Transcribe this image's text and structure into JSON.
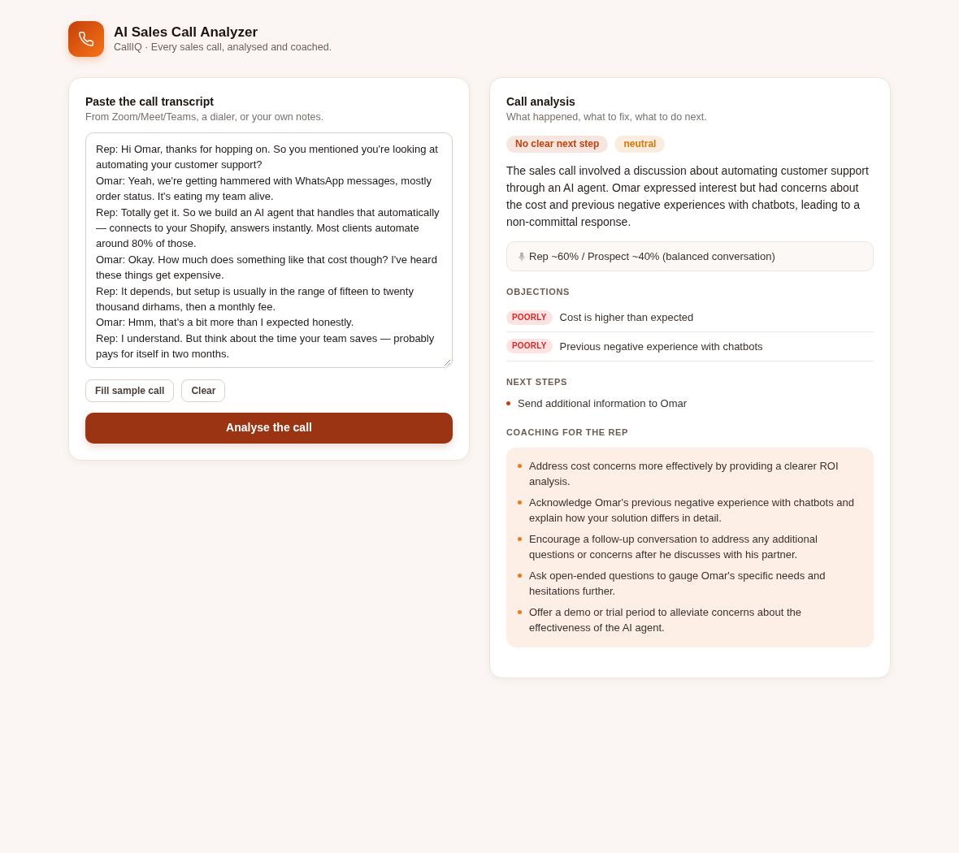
{
  "header": {
    "title": "AI Sales Call Analyzer",
    "subtitle": "CallIQ · Every sales call, analysed and coached."
  },
  "transcript_panel": {
    "title": "Paste the call transcript",
    "subtitle": "From Zoom/Meet/Teams, a dialer, or your own notes.",
    "transcript": [
      "Rep: Hi Omar, thanks for hopping on. So you mentioned you're looking at automating your customer support?",
      "Omar: Yeah, we're getting hammered with WhatsApp messages, mostly order status. It's eating my team alive.",
      "Rep: Totally get it. So we build an AI agent that handles that automatically — connects to your Shopify, answers instantly. Most clients automate around 80% of those.",
      "Omar: Okay. How much does something like that cost though? I've heard these things get expensive.",
      "Rep: It depends, but setup is usually in the range of fifteen to twenty thousand dirhams, then a monthly fee.",
      "Omar: Hmm, that's a bit more than I expected honestly.",
      "Rep: I understand. But think about the time your team saves — probably pays for itself in two months."
    ],
    "buttons": [
      {
        "label": "Fill sample call",
        "kind": "secondary"
      },
      {
        "label": "Clear",
        "kind": "secondary"
      },
      {
        "label": "Analyse the call",
        "kind": "primary"
      }
    ]
  },
  "analysis_panel": {
    "title": "Call analysis",
    "subtitle": "What happened, what to fix, what to do next.",
    "tags": [
      {
        "label": "No clear next step",
        "color": "#c2410c"
      },
      {
        "label": "neutral",
        "color": "#d97706"
      }
    ],
    "summary": "The sales call involved a discussion about automating customer support through an AI agent. Omar expressed interest but had concerns about the cost and previous negative experiences with chatbots, leading to a non-committal response.",
    "talk_ratio": "Rep ~60% / Prospect ~40% (balanced conversation)",
    "objections": {
      "heading": "OBJECTIONS",
      "items": [
        {
          "handling": "POORLY",
          "text": "Cost is higher than expected"
        },
        {
          "handling": "POORLY",
          "text": "Previous negative experience with chatbots"
        }
      ]
    },
    "next_steps": {
      "heading": "NEXT STEPS",
      "items": [
        "Send additional information to Omar"
      ]
    },
    "coaching": {
      "heading": "COACHING FOR THE REP",
      "items": [
        "Address cost concerns more effectively by providing a clearer ROI analysis.",
        "Acknowledge Omar's previous negative experience with chatbots and explain how your solution differs in detail.",
        "Encourage a follow-up conversation to address any additional questions or concerns after he discusses with his partner.",
        "Ask open-ended questions to gauge Omar's specific needs and hesitations further.",
        "Offer a demo or trial period to alleviate concerns about the effectiveness of the AI agent."
      ]
    }
  }
}
